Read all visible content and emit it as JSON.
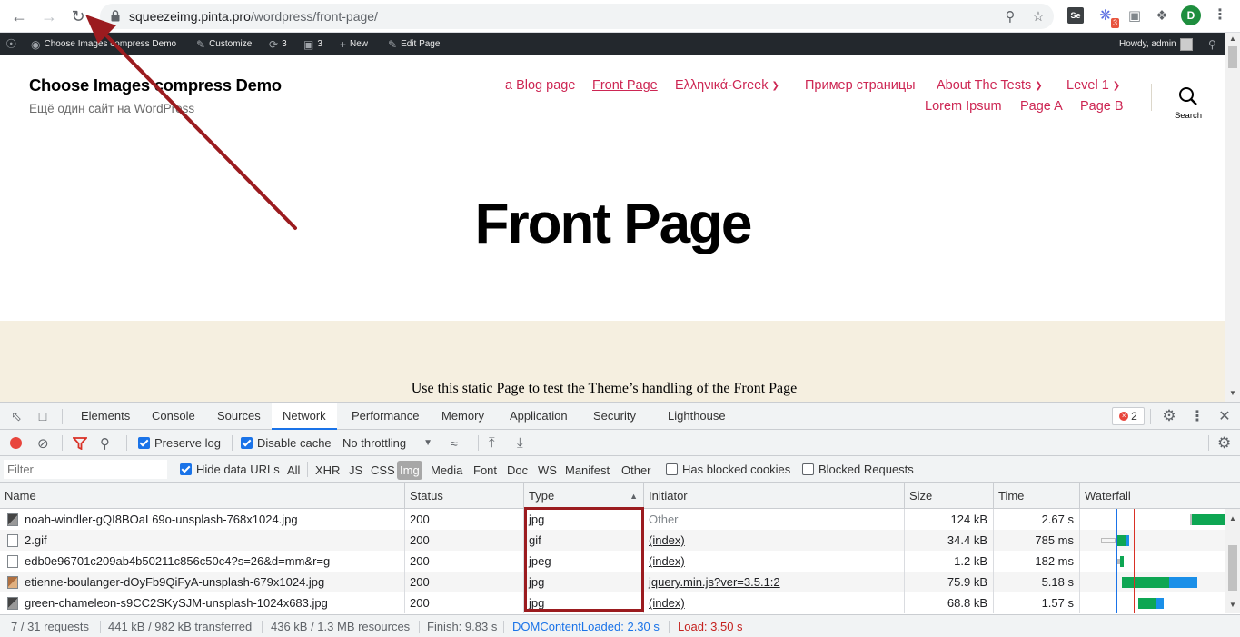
{
  "browser": {
    "url_host": "squeezeimg.pinta.pro",
    "url_path": "/wordpress/front-page/",
    "extension_badge": "3",
    "se_label": "Se",
    "profile_initial": "D"
  },
  "adminbar": {
    "site_name": "Choose Images compress Demo",
    "customize": "Customize",
    "updates_count": "3",
    "comments_count": "3",
    "new_label": "New",
    "edit_page": "Edit Page",
    "howdy": "Howdy, admin"
  },
  "site": {
    "title": "Choose Images compress Demo",
    "description": "Ещё один сайт на WordPress",
    "menu": {
      "blog": "a Blog page",
      "front": "Front Page",
      "greek": "Ελληνικά-Greek",
      "example": "Пример страницы",
      "about": "About The Tests",
      "level1": "Level 1",
      "lorem": "Lorem Ipsum",
      "page_a": "Page A",
      "page_b": "Page B"
    },
    "search_label": "Search",
    "page_title": "Front Page",
    "body_text": "Use this static Page to test the Theme’s handling of the Front Page"
  },
  "devtools": {
    "tabs": {
      "elements": "Elements",
      "console": "Console",
      "sources": "Sources",
      "network": "Network",
      "performance": "Performance",
      "memory": "Memory",
      "application": "Application",
      "security": "Security",
      "lighthouse": "Lighthouse"
    },
    "error_count": "2",
    "toolbar": {
      "preserve_log": "Preserve log",
      "disable_cache": "Disable cache",
      "throttling": "No throttling"
    },
    "filter": {
      "placeholder": "Filter",
      "hide_data_urls": "Hide data URLs",
      "types": {
        "all": "All",
        "xhr": "XHR",
        "js": "JS",
        "css": "CSS",
        "img": "Img",
        "media": "Media",
        "font": "Font",
        "doc": "Doc",
        "ws": "WS",
        "manifest": "Manifest",
        "other": "Other"
      },
      "has_blocked_cookies": "Has blocked cookies",
      "blocked_requests": "Blocked Requests"
    },
    "columns": {
      "name": "Name",
      "status": "Status",
      "type": "Type",
      "initiator": "Initiator",
      "size": "Size",
      "time": "Time",
      "waterfall": "Waterfall"
    },
    "rows": [
      {
        "name": "noah-windler-gQI8BOaL69o-unsplash-768x1024.jpg",
        "status": "200",
        "type": "jpg",
        "initiator": "Other",
        "size": "124 kB",
        "time": "2.67 s"
      },
      {
        "name": "2.gif",
        "status": "200",
        "type": "gif",
        "initiator": "(index)",
        "size": "34.4 kB",
        "time": "785 ms"
      },
      {
        "name": "edb0e96701c209ab4b50211c856c50c4?s=26&d=mm&r=g",
        "status": "200",
        "type": "jpeg",
        "initiator": "(index)",
        "size": "1.2 kB",
        "time": "182 ms"
      },
      {
        "name": "etienne-boulanger-dOyFb9QiFyA-unsplash-679x1024.jpg",
        "status": "200",
        "type": "jpg",
        "initiator": "jquery.min.js?ver=3.5.1:2",
        "size": "75.9 kB",
        "time": "5.18 s"
      },
      {
        "name": "green-chameleon-s9CC2SKySJM-unsplash-1024x683.jpg",
        "status": "200",
        "type": "jpg",
        "initiator": "(index)",
        "size": "68.8 kB",
        "time": "1.57 s"
      }
    ],
    "status_bar": {
      "requests": "7 / 31 requests",
      "transferred": "441 kB / 982 kB transferred",
      "resources": "436 kB / 1.3 MB resources",
      "finish": "Finish: 9.83 s",
      "dom": "DOMContentLoaded: 2.30 s",
      "load": "Load: 3.50 s"
    }
  },
  "colors": {
    "accent": "#cd2653",
    "annotation": "#9b1b1f",
    "devtools_blue": "#1a73e8"
  }
}
